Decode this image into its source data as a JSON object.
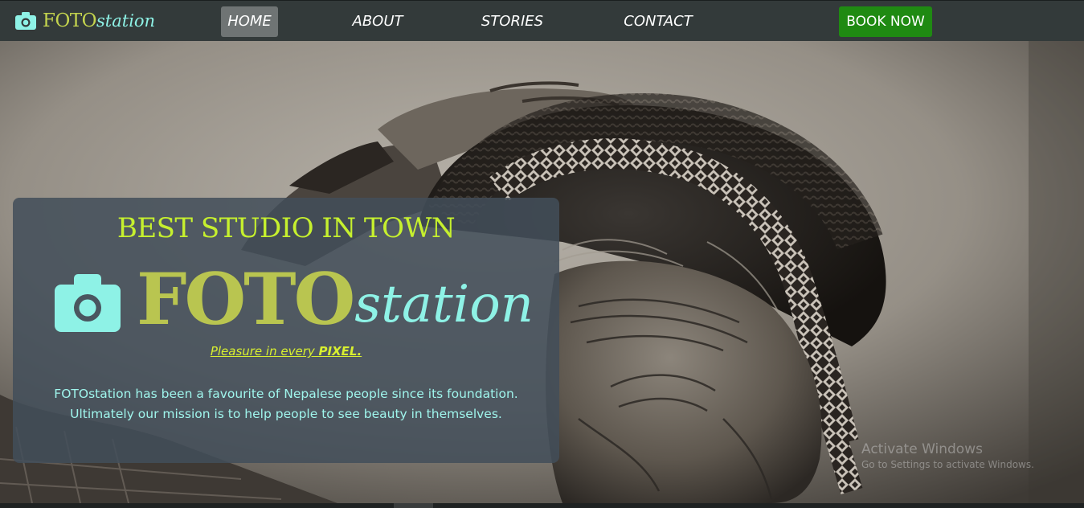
{
  "brand": {
    "foto": "FOTO",
    "station": "station",
    "icon": "camera-icon",
    "foto_color": "#c4d44e",
    "station_color": "#8ef2e6"
  },
  "nav": {
    "home": "HOME",
    "about": "ABOUT",
    "stories": "STORIES",
    "contact": "CONTACT",
    "active": "HOME"
  },
  "book_button": {
    "label": "BOOK NOW",
    "color": "#1f8a12"
  },
  "hero": {
    "tagline": "BEST STUDIO IN TOWN",
    "logo_foto": "FOTO",
    "logo_station": "station",
    "motto_prefix": "Pleasure in every ",
    "motto_emphasis": "PIXEL.",
    "description_line1": "FOTOstation has been a favourite of Nepalese people since its foundation.",
    "description_line2": "Ultimately our mission is to help people to see beauty in themselves."
  },
  "watermark": {
    "title": "Activate Windows",
    "subtitle": "Go to Settings to activate Windows."
  }
}
